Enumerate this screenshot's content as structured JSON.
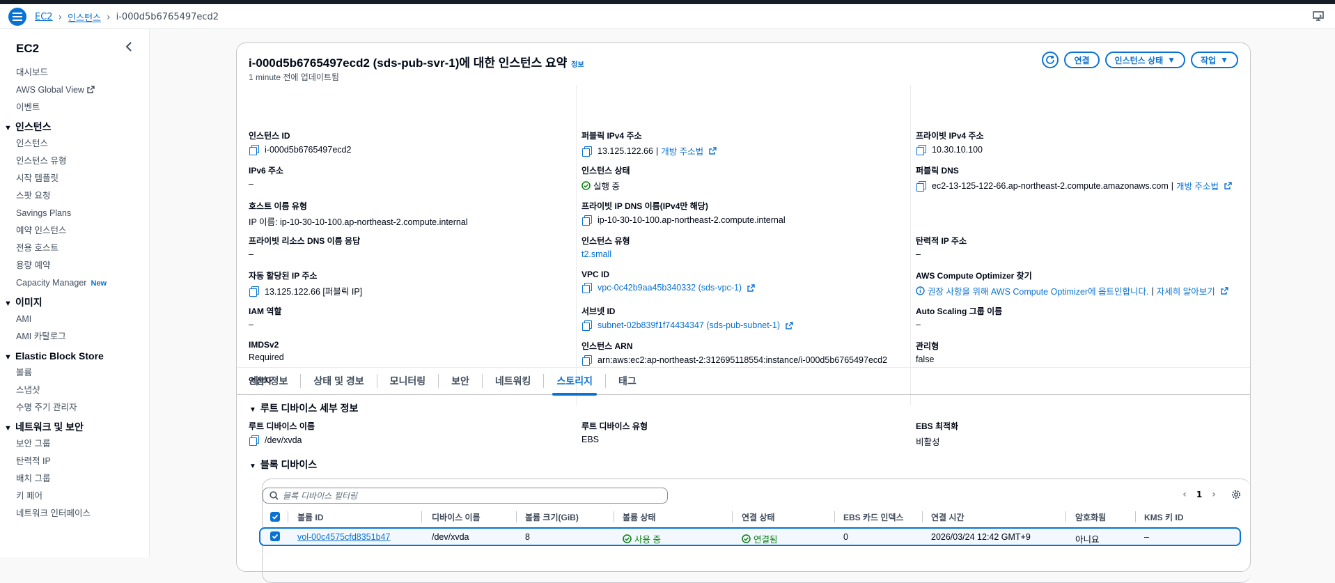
{
  "breadcrumb": {
    "items": [
      "EC2",
      "인스턴스"
    ],
    "current": "i-000d5b6765497ecd2"
  },
  "sidebar": {
    "title": "EC2",
    "top_items": [
      "대시보드",
      "AWS Global View",
      "이벤트"
    ],
    "sections": [
      {
        "label": "인스턴스",
        "items": [
          "인스턴스",
          "인스턴스 유형",
          "시작 템플릿",
          "스팟 요청",
          "Savings Plans",
          "예약 인스턴스",
          "전용 호스트",
          "용량 예약",
          "Capacity Manager"
        ]
      },
      {
        "label": "이미지",
        "items": [
          "AMI",
          "AMI 카탈로그"
        ]
      },
      {
        "label": "Elastic Block Store",
        "items": [
          "볼륨",
          "스냅샷",
          "수명 주기 관리자"
        ]
      },
      {
        "label": "네트워크 및 보안",
        "items": [
          "보안 그룹",
          "탄력적 IP",
          "배치 그룹",
          "키 페어",
          "네트워크 인터페이스"
        ]
      }
    ],
    "new_badge": "New"
  },
  "summary": {
    "title": "i-000d5b6765497ecd2 (sds-pub-svr-1)에 대한 인스턴스 요약",
    "info": "정보",
    "updated": "1 minute 전에 업데이트됨",
    "actions": {
      "connect": "연결",
      "state": "인스턴스 상태",
      "action": "작업"
    },
    "col1": [
      {
        "k": "인스턴스 ID",
        "v": "i-000d5b6765497ecd2"
      },
      {
        "k": "IPv6 주소",
        "v": "–"
      },
      {
        "k": "호스트 이름 유형",
        "v": "IP 이름: ip-10-30-10-100.ap-northeast-2.compute.internal"
      },
      {
        "k": "프라이빗 리소스 DNS 이름 응답",
        "v": "–"
      },
      {
        "k": "자동 할당된 IP 주소",
        "v": "13.125.122.66 [퍼블릭 IP]"
      },
      {
        "k": "IAM 역할",
        "v": "–"
      },
      {
        "k": "IMDSv2",
        "v": "Required"
      },
      {
        "k": "연산자",
        "v": "–"
      }
    ],
    "col2": [
      {
        "k": "퍼블릭 IPv4 주소",
        "v": "13.125.122.66",
        "link": "개방 주소법"
      },
      {
        "k": "인스턴스 상태",
        "v": "실행 중"
      },
      {
        "k": "프라이빗 IP DNS 이름(IPv4만 해당)",
        "v": "ip-10-30-10-100.ap-northeast-2.compute.internal"
      },
      {
        "k": "인스턴스 유형",
        "v": "t2.small"
      },
      {
        "k": "VPC ID",
        "v": "vpc-0c42b9aa45b340332 (sds-vpc-1)"
      },
      {
        "k": "서브넷 ID",
        "v": "subnet-02b839f1f74434347 (sds-pub-subnet-1)"
      },
      {
        "k": "인스턴스 ARN",
        "v": "arn:aws:ec2:ap-northeast-2:312695118554:instance/i-000d5b6765497ecd2"
      }
    ],
    "col3": [
      {
        "k": "프라이빗 IPv4 주소",
        "v": "10.30.10.100"
      },
      {
        "k": "퍼블릭 DNS",
        "v": "ec2-13-125-122-66.ap-northeast-2.compute.amazonaws.com",
        "link": "개방 주소법"
      },
      {
        "k": "탄력적 IP 주소",
        "v": "–"
      },
      {
        "k": "AWS Compute Optimizer 찾기",
        "v": "권장 사항을 위해 AWS Compute Optimizer에 옵트인합니다.",
        "link": "자세히 알아보기"
      },
      {
        "k": "Auto Scaling 그룹 이름",
        "v": "–"
      },
      {
        "k": "관리형",
        "v": "false"
      }
    ],
    "pipe": "|"
  },
  "tabs": [
    "세부 정보",
    "상태 및 경보",
    "모니터링",
    "보안",
    "네트워킹",
    "스토리지",
    "태그"
  ],
  "storage": {
    "root_header": "루트 디바이스 세부 정보",
    "root_name_k": "루트 디바이스 이름",
    "root_name_v": "/dev/xvda",
    "root_type_k": "루트 디바이스 유형",
    "root_type_v": "EBS",
    "ebs_opt_k": "EBS 최적화",
    "ebs_opt_v": "비활성",
    "block_header": "블록 디바이스",
    "filter_placeholder": "블록 디바이스 필터링",
    "page": "1",
    "columns": [
      "볼륨 ID",
      "디바이스 이름",
      "볼륨 크기(GiB)",
      "볼륨 상태",
      "연결 상태",
      "EBS 카드 인덱스",
      "연결 시간",
      "암호화됨",
      "KMS 키 ID"
    ],
    "row": [
      "vol-00c4575cfd8351b47",
      "/dev/xvda",
      "8",
      "사용 중",
      "연결됨",
      "0",
      "2026/03/24 12:42 GMT+9",
      "아니요",
      "–"
    ]
  },
  "colors": {
    "accent": "#0972d3",
    "success": "#037f0c",
    "header": "#161d26"
  }
}
